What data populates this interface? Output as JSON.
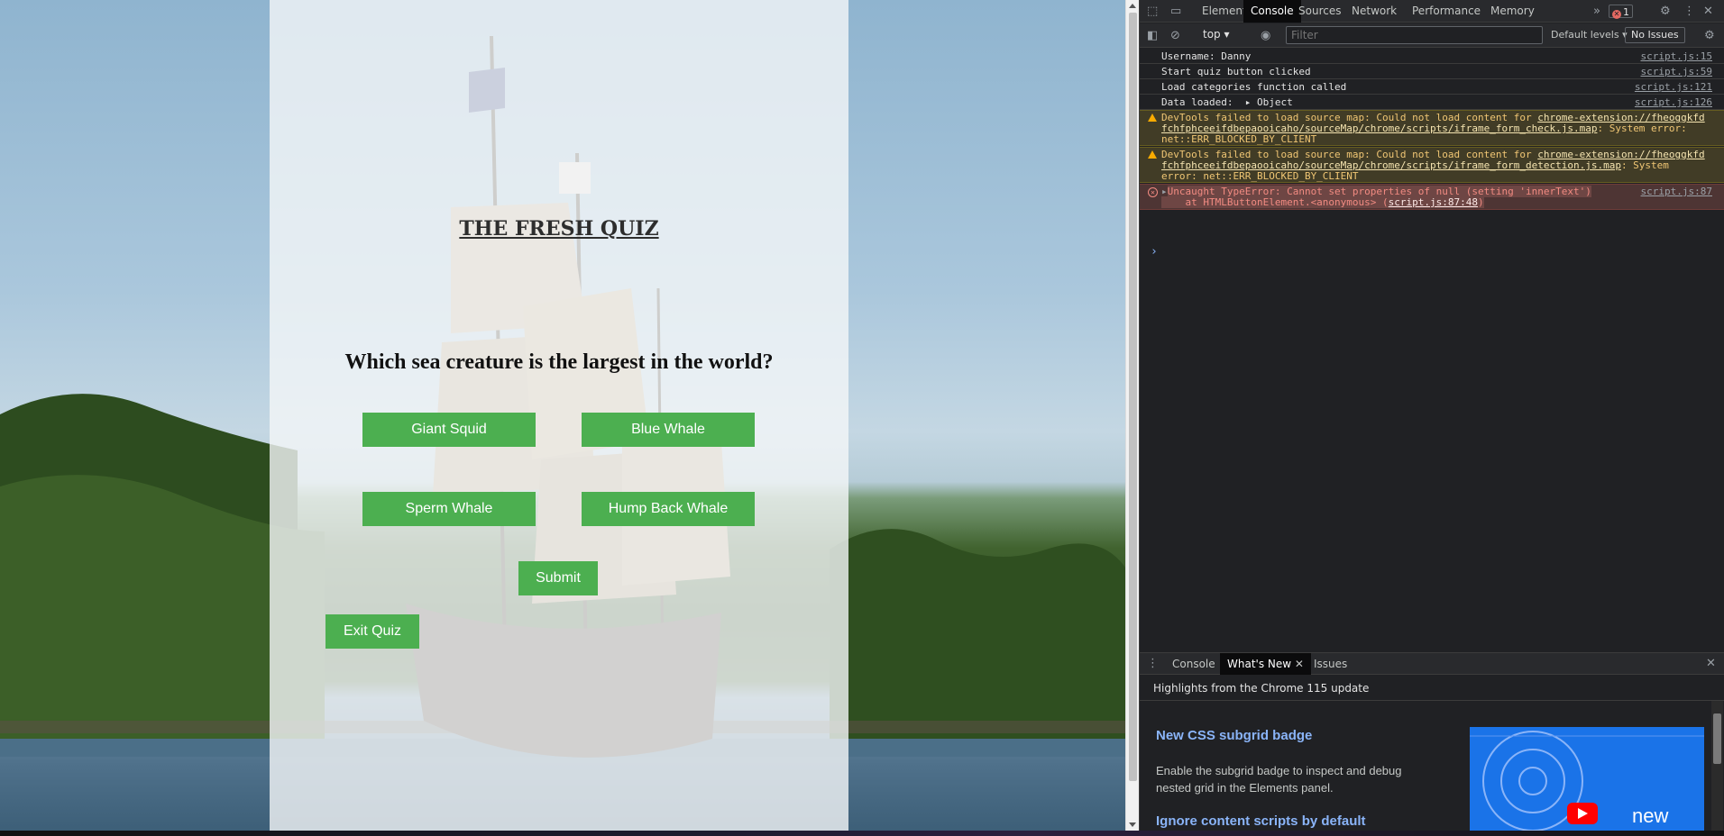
{
  "quiz": {
    "title": "THE FRESH QUIZ",
    "question": "Which sea creature is the largest in the world?",
    "answers": [
      "Giant Squid",
      "Blue Whale",
      "Sperm Whale",
      "Hump Back Whale"
    ],
    "submit_label": "Submit",
    "exit_label": "Exit Quiz",
    "button_color": "#4caf50"
  },
  "devtools": {
    "tabs": [
      "Elements",
      "Console",
      "Sources",
      "Network",
      "Performance",
      "Memory"
    ],
    "active_tab": "Console",
    "more_tabs_glyph": "»",
    "error_count": "1",
    "toolbar": {
      "context": "top",
      "filter_placeholder": "Filter",
      "levels": "Default levels",
      "issues": "No Issues"
    },
    "console": {
      "logs": [
        {
          "text": "Username: Danny",
          "source": "script.js:15"
        },
        {
          "text": "Start quiz button clicked",
          "source": "script.js:59"
        },
        {
          "text": "Load categories function called",
          "source": "script.js:121"
        },
        {
          "text": "Data loaded:  ▸ Object",
          "source": "script.js:126"
        }
      ],
      "warnings": [
        {
          "line1": "DevTools failed to load source map: Could not load content for ",
          "link1": "chrome-extension://fheoggkfd",
          "line2_link": "fchfphceeifdbepaooicaho/sourceMap/chrome/scripts/iframe_form_check.js.map",
          "line2_tail": ": System error:",
          "line3": "net::ERR_BLOCKED_BY_CLIENT"
        },
        {
          "line1": "DevTools failed to load source map: Could not load content for ",
          "link1": "chrome-extension://fheoggkfd",
          "line2_link": "fchfphceeifdbepaooicaho/sourceMap/chrome/scripts/iframe_form_detection.js.map",
          "line2_tail": ": System",
          "line3": "error: net::ERR_BLOCKED_BY_CLIENT"
        }
      ],
      "error": {
        "line1": "Uncaught TypeError: Cannot set properties of null (setting 'innerText')",
        "line2": "    at HTMLButtonElement.<anonymous> (",
        "line2_link": "script.js:87:48",
        "line2_end": ")",
        "source": "script.js:87"
      },
      "prompt": "›"
    },
    "drawer": {
      "tabs": [
        "Console",
        "What's New",
        "Issues"
      ],
      "active_tab": "What's New",
      "subtitle": "Highlights from the Chrome 115 update",
      "item1_title": "New CSS subgrid badge",
      "item1_desc": "Enable the subgrid badge to inspect and debug nested grid in the Elements panel.",
      "item2_title": "Ignore content scripts by default",
      "thumb_text": "new"
    }
  }
}
